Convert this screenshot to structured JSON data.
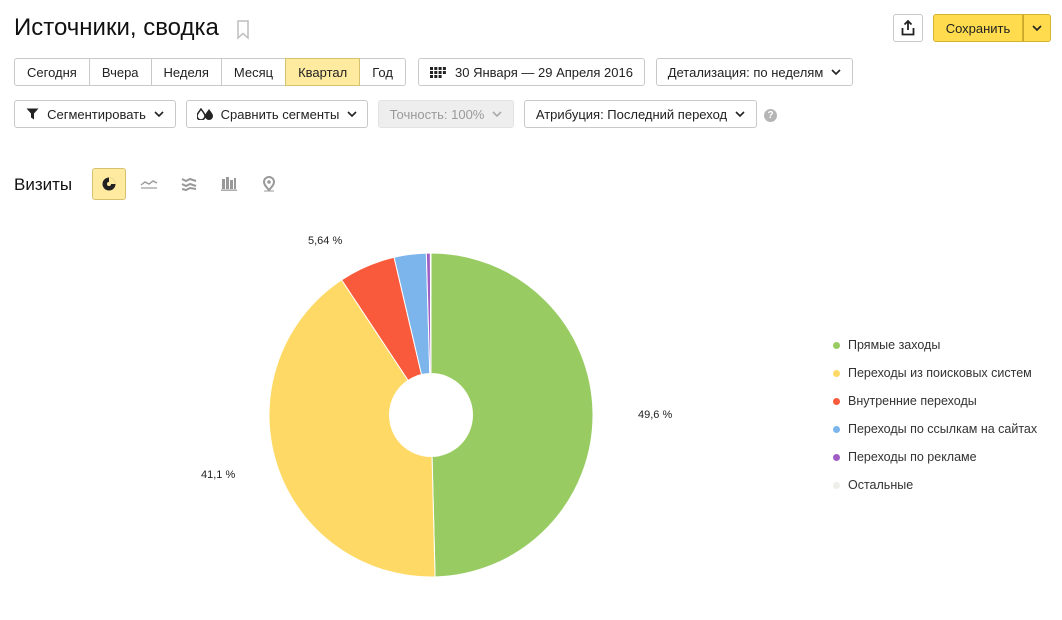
{
  "header": {
    "title": "Источники, сводка",
    "save_label": "Сохранить"
  },
  "periods": [
    {
      "label": "Сегодня",
      "active": false
    },
    {
      "label": "Вчера",
      "active": false
    },
    {
      "label": "Неделя",
      "active": false
    },
    {
      "label": "Месяц",
      "active": false
    },
    {
      "label": "Квартал",
      "active": true
    },
    {
      "label": "Год",
      "active": false
    }
  ],
  "date_range": "30 Января — 29 Апреля 2016",
  "detail_label": "Детализация: по неделям",
  "filters": {
    "segment_label": "Сегментировать",
    "compare_label": "Сравнить сегменты",
    "accuracy_label": "Точность: 100%",
    "attribution_label": "Атрибуция: Последний переход",
    "help_symbol": "?"
  },
  "chart_section": {
    "label": "Визиты",
    "view_icons": [
      "pie-chart-icon",
      "line-chart-icon",
      "area-chart-icon",
      "bar-chart-icon",
      "map-pin-icon"
    ],
    "active_view": "pie-chart-icon"
  },
  "chart_data": {
    "type": "pie",
    "donut": true,
    "legend_position": "right",
    "series": [
      {
        "name": "Прямые заходы",
        "value": 49.6,
        "label": "49,6 %",
        "color": "#98cc63"
      },
      {
        "name": "Переходы из поисковых систем",
        "value": 41.1,
        "label": "41,1 %",
        "color": "#ffd966"
      },
      {
        "name": "Внутренние переходы",
        "value": 5.64,
        "label": "5,64 %",
        "color": "#fa5a3c"
      },
      {
        "name": "Переходы по ссылкам на сайтах",
        "value": 3.2,
        "label": "",
        "color": "#7cb5ec"
      },
      {
        "name": "Переходы по рекламе",
        "value": 0.4,
        "label": "",
        "color": "#a05ec4"
      },
      {
        "name": "Остальные",
        "value": 0.06,
        "label": "",
        "color": "#eeeeea"
      }
    ]
  }
}
